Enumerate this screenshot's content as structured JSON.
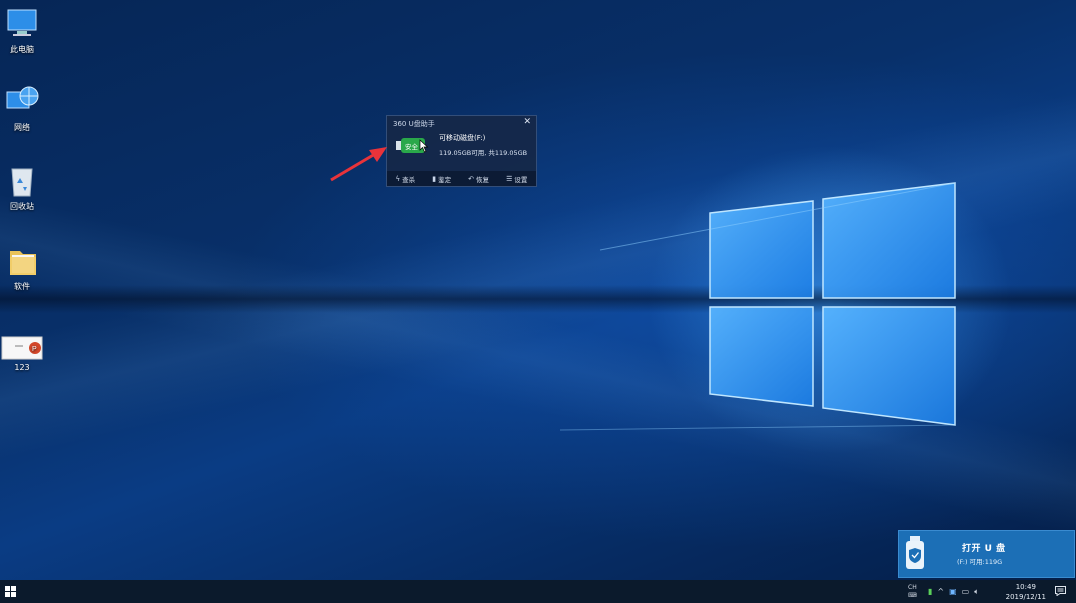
{
  "desktop": {
    "icons": [
      {
        "label": "此电脑",
        "icon": "computer-icon"
      },
      {
        "label": "网络",
        "icon": "network-icon"
      },
      {
        "label": "回收站",
        "icon": "recycle-bin-icon"
      },
      {
        "label": "软件",
        "icon": "folder-icon"
      },
      {
        "label": "123",
        "icon": "powerpoint-file-icon"
      }
    ]
  },
  "popup": {
    "title": "360 U盘助手",
    "badge_label": "安全",
    "drive_name": "可移动磁盘(F:)",
    "capacity": "119.05GB可用, 共119.05GB",
    "actions": [
      {
        "label": "查杀",
        "icon": "lightning-icon"
      },
      {
        "label": "鉴定",
        "icon": "usb-icon"
      },
      {
        "label": "恢复",
        "icon": "restore-icon"
      },
      {
        "label": "设置",
        "icon": "menu-icon"
      }
    ],
    "badge_color": "#2aa84a"
  },
  "toast": {
    "title": "打开 U 盘",
    "subtitle": "(F:)  可用:119G",
    "color": "#1c6fb6"
  },
  "taskbar": {
    "ime": "CH",
    "time": "10:49",
    "date": "2019/12/11"
  }
}
